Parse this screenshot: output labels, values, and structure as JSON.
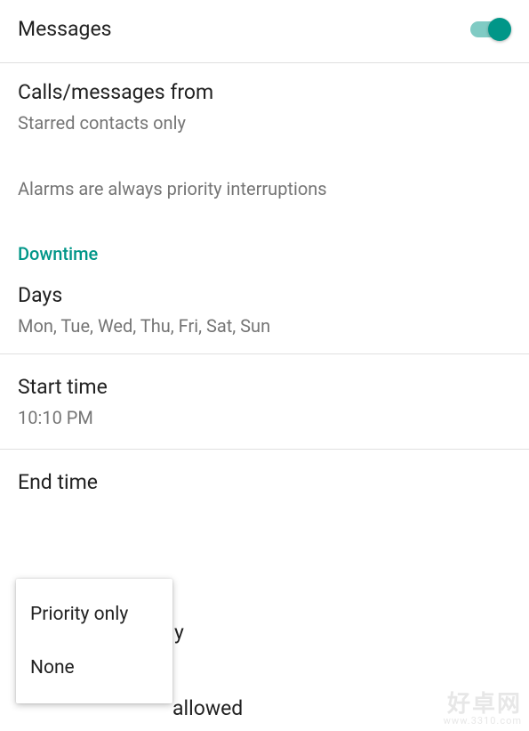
{
  "messages": {
    "label": "Messages",
    "toggle_on": true
  },
  "calls_from": {
    "title": "Calls/messages from",
    "subtitle": "Starred contacts only"
  },
  "alarms_note": "Alarms are always priority interruptions",
  "downtime": {
    "header": "Downtime",
    "days": {
      "title": "Days",
      "subtitle": "Mon, Tue, Wed, Thu, Fri, Sat, Sun"
    },
    "start_time": {
      "title": "Start time",
      "subtitle": "10:10 PM"
    },
    "end_time": {
      "title": "End time"
    }
  },
  "popup": {
    "items": [
      "Priority only",
      "None"
    ]
  },
  "behind_text": {
    "frag1": "y",
    "frag2": "allowed"
  },
  "watermark": {
    "main": "好卓网",
    "sub": "www.3310.com"
  }
}
